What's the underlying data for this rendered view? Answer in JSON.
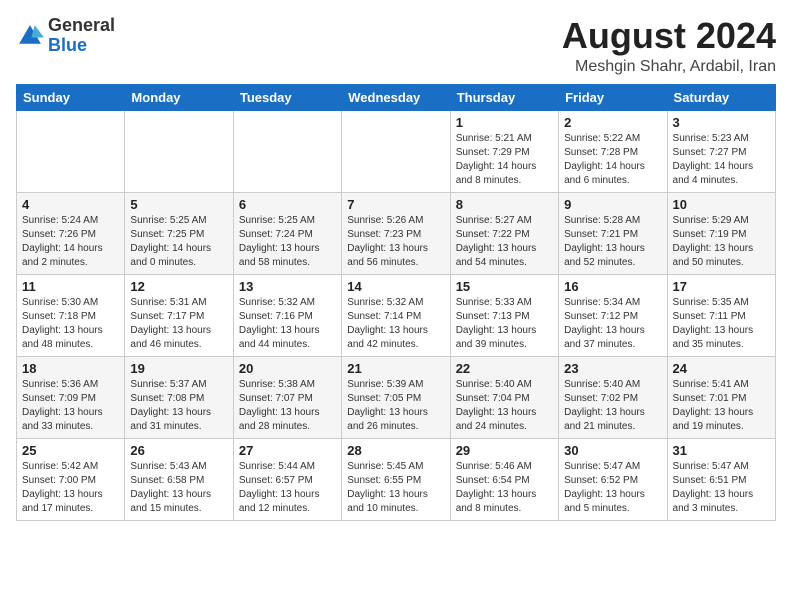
{
  "logo": {
    "general": "General",
    "blue": "Blue"
  },
  "header": {
    "month_year": "August 2024",
    "location": "Meshgin Shahr, Ardabil, Iran"
  },
  "weekdays": [
    "Sunday",
    "Monday",
    "Tuesday",
    "Wednesday",
    "Thursday",
    "Friday",
    "Saturday"
  ],
  "weeks": [
    [
      {
        "day": "",
        "info": ""
      },
      {
        "day": "",
        "info": ""
      },
      {
        "day": "",
        "info": ""
      },
      {
        "day": "",
        "info": ""
      },
      {
        "day": "1",
        "info": "Sunrise: 5:21 AM\nSunset: 7:29 PM\nDaylight: 14 hours\nand 8 minutes."
      },
      {
        "day": "2",
        "info": "Sunrise: 5:22 AM\nSunset: 7:28 PM\nDaylight: 14 hours\nand 6 minutes."
      },
      {
        "day": "3",
        "info": "Sunrise: 5:23 AM\nSunset: 7:27 PM\nDaylight: 14 hours\nand 4 minutes."
      }
    ],
    [
      {
        "day": "4",
        "info": "Sunrise: 5:24 AM\nSunset: 7:26 PM\nDaylight: 14 hours\nand 2 minutes."
      },
      {
        "day": "5",
        "info": "Sunrise: 5:25 AM\nSunset: 7:25 PM\nDaylight: 14 hours\nand 0 minutes."
      },
      {
        "day": "6",
        "info": "Sunrise: 5:25 AM\nSunset: 7:24 PM\nDaylight: 13 hours\nand 58 minutes."
      },
      {
        "day": "7",
        "info": "Sunrise: 5:26 AM\nSunset: 7:23 PM\nDaylight: 13 hours\nand 56 minutes."
      },
      {
        "day": "8",
        "info": "Sunrise: 5:27 AM\nSunset: 7:22 PM\nDaylight: 13 hours\nand 54 minutes."
      },
      {
        "day": "9",
        "info": "Sunrise: 5:28 AM\nSunset: 7:21 PM\nDaylight: 13 hours\nand 52 minutes."
      },
      {
        "day": "10",
        "info": "Sunrise: 5:29 AM\nSunset: 7:19 PM\nDaylight: 13 hours\nand 50 minutes."
      }
    ],
    [
      {
        "day": "11",
        "info": "Sunrise: 5:30 AM\nSunset: 7:18 PM\nDaylight: 13 hours\nand 48 minutes."
      },
      {
        "day": "12",
        "info": "Sunrise: 5:31 AM\nSunset: 7:17 PM\nDaylight: 13 hours\nand 46 minutes."
      },
      {
        "day": "13",
        "info": "Sunrise: 5:32 AM\nSunset: 7:16 PM\nDaylight: 13 hours\nand 44 minutes."
      },
      {
        "day": "14",
        "info": "Sunrise: 5:32 AM\nSunset: 7:14 PM\nDaylight: 13 hours\nand 42 minutes."
      },
      {
        "day": "15",
        "info": "Sunrise: 5:33 AM\nSunset: 7:13 PM\nDaylight: 13 hours\nand 39 minutes."
      },
      {
        "day": "16",
        "info": "Sunrise: 5:34 AM\nSunset: 7:12 PM\nDaylight: 13 hours\nand 37 minutes."
      },
      {
        "day": "17",
        "info": "Sunrise: 5:35 AM\nSunset: 7:11 PM\nDaylight: 13 hours\nand 35 minutes."
      }
    ],
    [
      {
        "day": "18",
        "info": "Sunrise: 5:36 AM\nSunset: 7:09 PM\nDaylight: 13 hours\nand 33 minutes."
      },
      {
        "day": "19",
        "info": "Sunrise: 5:37 AM\nSunset: 7:08 PM\nDaylight: 13 hours\nand 31 minutes."
      },
      {
        "day": "20",
        "info": "Sunrise: 5:38 AM\nSunset: 7:07 PM\nDaylight: 13 hours\nand 28 minutes."
      },
      {
        "day": "21",
        "info": "Sunrise: 5:39 AM\nSunset: 7:05 PM\nDaylight: 13 hours\nand 26 minutes."
      },
      {
        "day": "22",
        "info": "Sunrise: 5:40 AM\nSunset: 7:04 PM\nDaylight: 13 hours\nand 24 minutes."
      },
      {
        "day": "23",
        "info": "Sunrise: 5:40 AM\nSunset: 7:02 PM\nDaylight: 13 hours\nand 21 minutes."
      },
      {
        "day": "24",
        "info": "Sunrise: 5:41 AM\nSunset: 7:01 PM\nDaylight: 13 hours\nand 19 minutes."
      }
    ],
    [
      {
        "day": "25",
        "info": "Sunrise: 5:42 AM\nSunset: 7:00 PM\nDaylight: 13 hours\nand 17 minutes."
      },
      {
        "day": "26",
        "info": "Sunrise: 5:43 AM\nSunset: 6:58 PM\nDaylight: 13 hours\nand 15 minutes."
      },
      {
        "day": "27",
        "info": "Sunrise: 5:44 AM\nSunset: 6:57 PM\nDaylight: 13 hours\nand 12 minutes."
      },
      {
        "day": "28",
        "info": "Sunrise: 5:45 AM\nSunset: 6:55 PM\nDaylight: 13 hours\nand 10 minutes."
      },
      {
        "day": "29",
        "info": "Sunrise: 5:46 AM\nSunset: 6:54 PM\nDaylight: 13 hours\nand 8 minutes."
      },
      {
        "day": "30",
        "info": "Sunrise: 5:47 AM\nSunset: 6:52 PM\nDaylight: 13 hours\nand 5 minutes."
      },
      {
        "day": "31",
        "info": "Sunrise: 5:47 AM\nSunset: 6:51 PM\nDaylight: 13 hours\nand 3 minutes."
      }
    ]
  ]
}
